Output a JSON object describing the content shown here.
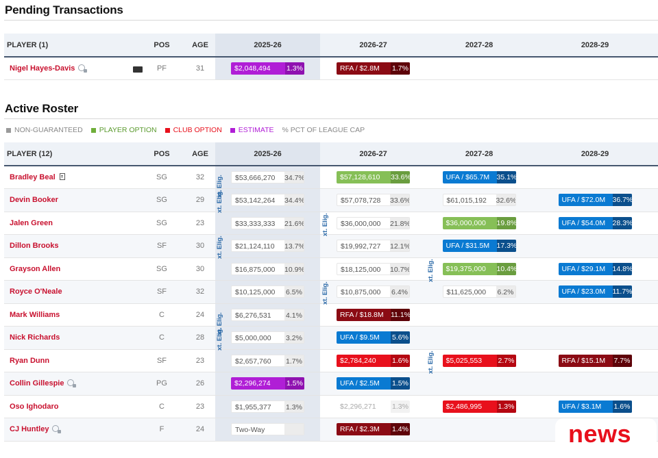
{
  "pending": {
    "title": "Pending Transactions",
    "headers": {
      "player": "PLAYER (1)",
      "pos": "POS",
      "age": "AGE",
      "y1": "2025-26",
      "y2": "2026-27",
      "y3": "2027-28",
      "y4": "2028-29"
    },
    "rows": [
      {
        "name": "Nigel Hayes-Davis",
        "pos": "PF",
        "age": "31",
        "c1": {
          "type": "estimate",
          "amount": "$2,048,494",
          "pct": "1.3%"
        },
        "c2": {
          "type": "rfa",
          "amount": "RFA / $2.8M",
          "pct": "1.7%"
        }
      }
    ]
  },
  "roster": {
    "title": "Active Roster",
    "legend": {
      "non_guaranteed": "NON-GUARANTEED",
      "player_option": "PLAYER OPTION",
      "club_option": "CLUB OPTION",
      "estimate": "ESTIMATE",
      "pct_cap": "% PCT OF LEAGUE CAP"
    },
    "headers": {
      "player": "PLAYER (12)",
      "pos": "POS",
      "age": "AGE",
      "y1": "2025-26",
      "y2": "2026-27",
      "y3": "2027-28",
      "y4": "2028-29"
    },
    "ext_label": "xt. Elig.",
    "rows": [
      {
        "name": "Bradley Beal",
        "pos": "SG",
        "age": "32",
        "c1": {
          "type": "plain",
          "amount": "$53,666,270",
          "pct": "34.7%"
        },
        "c2": {
          "type": "popt",
          "amount": "$57,128,610",
          "pct": "33.6%"
        },
        "c3": {
          "type": "ufa",
          "amount": "UFA / $65.7M",
          "pct": "35.1%"
        }
      },
      {
        "name": "Devin Booker",
        "pos": "SG",
        "age": "29",
        "c1": {
          "type": "plain",
          "amount": "$53,142,264",
          "pct": "34.4%"
        },
        "c2": {
          "type": "plain",
          "amount": "$57,078,728",
          "pct": "33.6%"
        },
        "c3": {
          "type": "plain",
          "amount": "$61,015,192",
          "pct": "32.6%"
        },
        "c4": {
          "type": "ufa",
          "amount": "UFA / $72.0M",
          "pct": "36.7%"
        }
      },
      {
        "name": "Jalen Green",
        "pos": "SG",
        "age": "23",
        "c1": {
          "type": "plain",
          "amount": "$33,333,333",
          "pct": "21.6%"
        },
        "c2": {
          "type": "plain",
          "amount": "$36,000,000",
          "pct": "21.8%"
        },
        "c3": {
          "type": "popt",
          "amount": "$36,000,000",
          "pct": "19.8%"
        },
        "c4": {
          "type": "ufa",
          "amount": "UFA / $54.0M",
          "pct": "28.3%"
        }
      },
      {
        "name": "Dillon Brooks",
        "pos": "SF",
        "age": "30",
        "c1": {
          "type": "plain",
          "amount": "$21,124,110",
          "pct": "13.7%"
        },
        "c2": {
          "type": "plain",
          "amount": "$19,992,727",
          "pct": "12.1%"
        },
        "c3": {
          "type": "ufa",
          "amount": "UFA / $31.5M",
          "pct": "17.3%"
        }
      },
      {
        "name": "Grayson Allen",
        "pos": "SG",
        "age": "30",
        "c1": {
          "type": "plain",
          "amount": "$16,875,000",
          "pct": "10.9%"
        },
        "c2": {
          "type": "plain",
          "amount": "$18,125,000",
          "pct": "10.7%"
        },
        "c3": {
          "type": "popt",
          "amount": "$19,375,000",
          "pct": "10.4%"
        },
        "c4": {
          "type": "ufa",
          "amount": "UFA / $29.1M",
          "pct": "14.8%"
        }
      },
      {
        "name": "Royce O'Neale",
        "pos": "SF",
        "age": "32",
        "c1": {
          "type": "plain",
          "amount": "$10,125,000",
          "pct": "6.5%"
        },
        "c2": {
          "type": "plain",
          "amount": "$10,875,000",
          "pct": "6.4%"
        },
        "c3": {
          "type": "plain",
          "amount": "$11,625,000",
          "pct": "6.2%"
        },
        "c4": {
          "type": "ufa",
          "amount": "UFA / $23.0M",
          "pct": "11.7%"
        }
      },
      {
        "name": "Mark Williams",
        "pos": "C",
        "age": "24",
        "c1": {
          "type": "plain",
          "amount": "$6,276,531",
          "pct": "4.1%"
        },
        "c2": {
          "type": "rfa",
          "amount": "RFA / $18.8M",
          "pct": "11.1%"
        }
      },
      {
        "name": "Nick Richards",
        "pos": "C",
        "age": "28",
        "c1": {
          "type": "plain",
          "amount": "$5,000,000",
          "pct": "3.2%"
        },
        "c2": {
          "type": "ufa",
          "amount": "UFA / $9.5M",
          "pct": "5.6%"
        }
      },
      {
        "name": "Ryan Dunn",
        "pos": "SF",
        "age": "23",
        "c1": {
          "type": "plain",
          "amount": "$2,657,760",
          "pct": "1.7%"
        },
        "c2": {
          "type": "club",
          "amount": "$2,784,240",
          "pct": "1.6%"
        },
        "c3": {
          "type": "club",
          "amount": "$5,025,553",
          "pct": "2.7%"
        },
        "c4": {
          "type": "rfa",
          "amount": "RFA / $15.1M",
          "pct": "7.7%"
        }
      },
      {
        "name": "Collin Gillespie",
        "pos": "PG",
        "age": "26",
        "c1": {
          "type": "estimate",
          "amount": "$2,296,274",
          "pct": "1.5%"
        },
        "c2": {
          "type": "ufa",
          "amount": "UFA / $2.5M",
          "pct": "1.5%"
        }
      },
      {
        "name": "Oso Ighodaro",
        "pos": "C",
        "age": "23",
        "c1": {
          "type": "plain",
          "amount": "$1,955,377",
          "pct": "1.3%"
        },
        "c2": {
          "type": "faded",
          "amount": "$2,296,271",
          "pct": "1.3%"
        },
        "c3": {
          "type": "club",
          "amount": "$2,486,995",
          "pct": "1.3%"
        },
        "c4": {
          "type": "ufa",
          "amount": "UFA / $3.1M",
          "pct": "1.6%"
        }
      },
      {
        "name": "CJ Huntley",
        "pos": "F",
        "age": "24",
        "c1": {
          "type": "twoway",
          "amount": "Two-Way",
          "pct": ""
        },
        "c2": {
          "type": "rfa",
          "amount": "RFA / $2.3M",
          "pct": "1.4%"
        }
      }
    ]
  },
  "colors": {
    "player_name": "#c8102e",
    "estimate": "#b01ed6",
    "rfa": "#8b0b14",
    "ufa": "#0a7ad2",
    "club_option": "#e8101c",
    "player_option": "#86bf57",
    "non_guaranteed": "#9a9a9a"
  },
  "watermark": "news"
}
